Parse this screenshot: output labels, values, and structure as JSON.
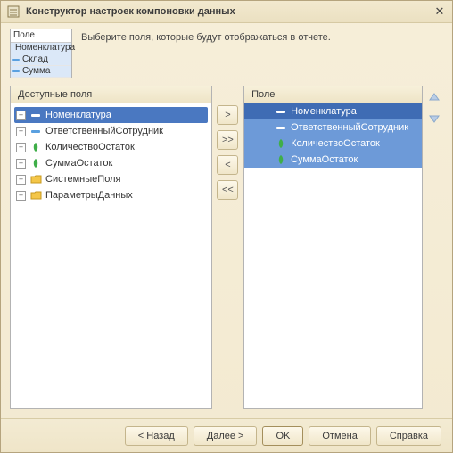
{
  "title": "Конструктор настроек компоновки данных",
  "intro": "Выберите поля, которые будут отображаться в отчете.",
  "preview": {
    "header": "Поле",
    "rows": [
      "Номенклатура",
      "Склад",
      "Сумма"
    ]
  },
  "left": {
    "header": "Доступные поля",
    "items": [
      {
        "label": "Номенклатура",
        "icon": "dash",
        "exp": true,
        "selected": true
      },
      {
        "label": "ОтветственныйСотрудник",
        "icon": "dash",
        "exp": true
      },
      {
        "label": "КоличествоОстаток",
        "icon": "green",
        "exp": true
      },
      {
        "label": "СуммаОстаток",
        "icon": "green",
        "exp": true
      },
      {
        "label": "СистемныеПоля",
        "icon": "folder",
        "exp": true
      },
      {
        "label": "ПараметрыДанных",
        "icon": "folder",
        "exp": true
      }
    ]
  },
  "right": {
    "header": "Поле",
    "items": [
      {
        "label": "Номенклатура",
        "icon": "dash"
      },
      {
        "label": "ОтветственныйСотрудник",
        "icon": "dash"
      },
      {
        "label": "КоличествоОстаток",
        "icon": "green"
      },
      {
        "label": "СуммаОстаток",
        "icon": "green"
      }
    ]
  },
  "mid": {
    "add": ">",
    "addall": ">>",
    "remove": "<",
    "removeall": "<<"
  },
  "arrows": {
    "up": "▲",
    "down": "▼"
  },
  "footer": {
    "back": "< Назад",
    "next": "Далее >",
    "ok": "OK",
    "cancel": "Отмена",
    "help": "Справка"
  }
}
